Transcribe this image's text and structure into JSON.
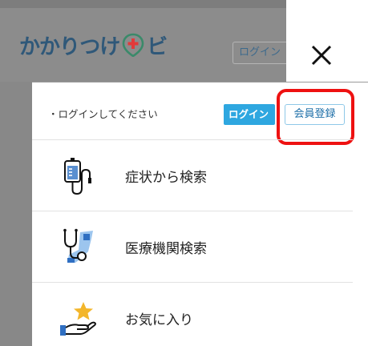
{
  "header": {
    "logo_left": "かかりつけ",
    "logo_right": "ビ",
    "login_label": "ログイン"
  },
  "menu": {
    "prompt": "・ログインしてください",
    "login_button": "ログイン",
    "register_button": "会員登録",
    "items": [
      {
        "label": "症状から検索",
        "icon": "iv-drip-icon"
      },
      {
        "label": "医療機関検索",
        "icon": "stethoscope-map-icon"
      },
      {
        "label": "お気に入り",
        "icon": "hand-star-icon"
      }
    ]
  },
  "colors": {
    "brand": "#2f5879",
    "accent": "#2ea7e0",
    "highlight": "#e11111"
  }
}
